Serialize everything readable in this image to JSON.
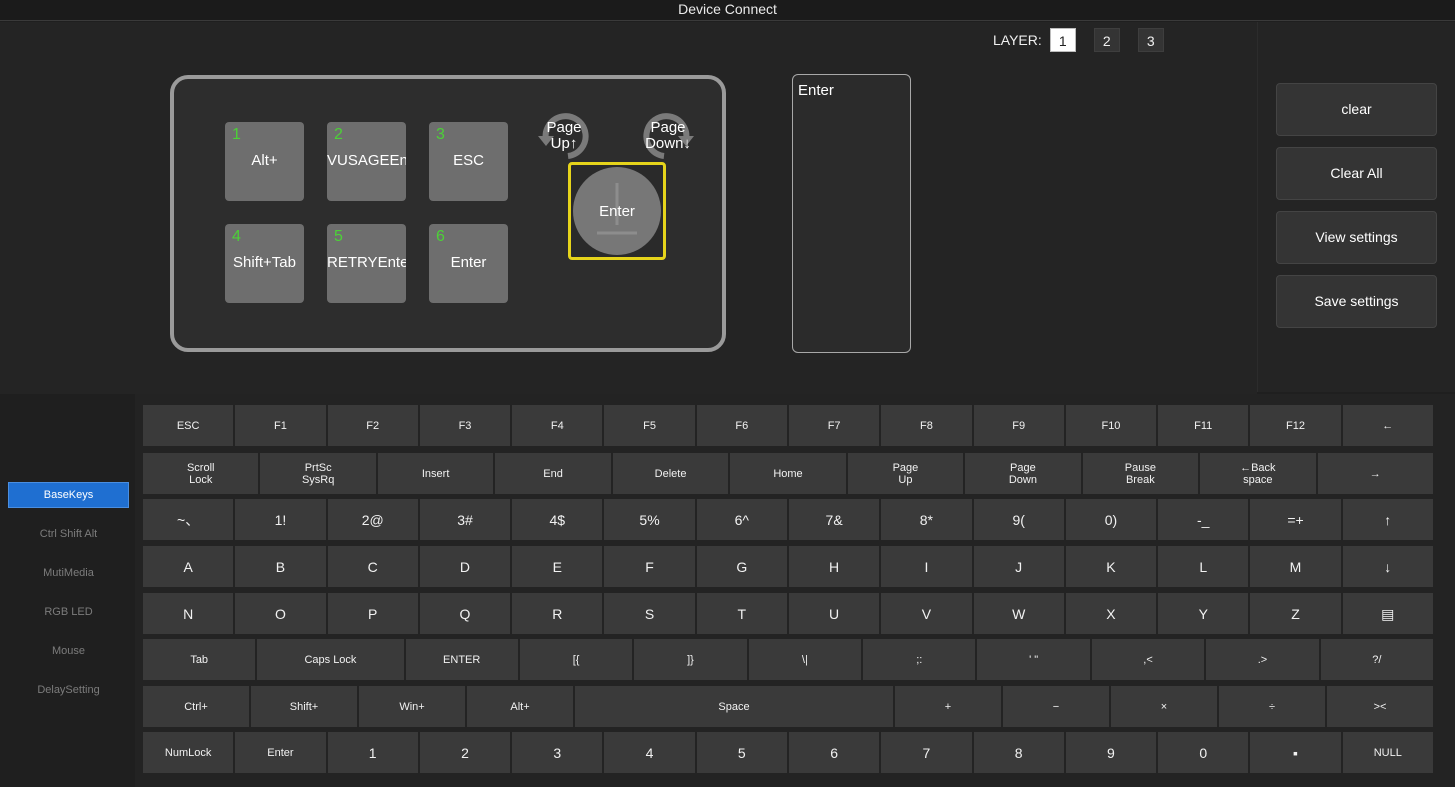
{
  "window": {
    "title": "Device Connect"
  },
  "layer": {
    "label": "LAYER:",
    "buttons": [
      "1",
      "2",
      "3"
    ],
    "active": "1"
  },
  "device": {
    "keys": [
      {
        "num": "1",
        "label": "Alt+"
      },
      {
        "num": "2",
        "label": "VUSAGEEnter"
      },
      {
        "num": "3",
        "label": "ESC"
      },
      {
        "num": "4",
        "label": "Shift+Tab"
      },
      {
        "num": "5",
        "label": "RETRYEnter"
      },
      {
        "num": "6",
        "label": "Enter"
      }
    ],
    "knob_left": {
      "line1": "Page",
      "line2": "Up↑"
    },
    "knob_right": {
      "line1": "Page",
      "line2": "Down↓"
    },
    "encoder": {
      "label": "Enter",
      "highlight_color": "#e6d41b"
    }
  },
  "preview": {
    "text": "Enter"
  },
  "actions": [
    "clear",
    "Clear All",
    "View settings",
    "Save settings"
  ],
  "sidebar": {
    "items": [
      "BaseKeys",
      "Ctrl Shift Alt",
      "MutiMedia",
      "RGB LED",
      "Mouse",
      "DelaySetting"
    ],
    "active": "BaseKeys",
    "accent": "#1f6fd1"
  },
  "keyboard": {
    "rows": [
      [
        "ESC",
        "F1",
        "F2",
        "F3",
        "F4",
        "F5",
        "F6",
        "F7",
        "F8",
        "F9",
        "F10",
        "F11",
        "F12",
        "←"
      ],
      [
        "Scroll\nLock",
        "PrtSc\nSysRq",
        "Insert",
        "End",
        "Delete",
        "Home",
        "Page\nUp",
        "Page\nDown",
        "Pause\nBreak",
        "←Back\nspace",
        "→"
      ],
      [
        "~、",
        "1!",
        "2@",
        "3#",
        "4$",
        "5%",
        "6^",
        "7&",
        "8*",
        "9(",
        "0)",
        "-_",
        "=+",
        "↑"
      ],
      [
        "A",
        "B",
        "C",
        "D",
        "E",
        "F",
        "G",
        "H",
        "I",
        "J",
        "K",
        "L",
        "M",
        "↓"
      ],
      [
        "N",
        "O",
        "P",
        "Q",
        "R",
        "S",
        "T",
        "U",
        "V",
        "W",
        "X",
        "Y",
        "Z",
        "▤"
      ],
      [
        "Tab",
        "Caps Lock",
        "ENTER",
        "[{",
        "]}",
        "\\|",
        ";:",
        "' \"",
        ",<",
        ".>",
        "?/"
      ],
      [
        "Ctrl+",
        "Shift+",
        "Win+",
        "Alt+",
        "Space",
        "+",
        "−",
        "×",
        "÷",
        "><"
      ],
      [
        "NumLock",
        "Enter",
        "1",
        "2",
        "3",
        "4",
        "5",
        "6",
        "7",
        "8",
        "9",
        "0",
        "▪",
        "NULL"
      ]
    ]
  }
}
